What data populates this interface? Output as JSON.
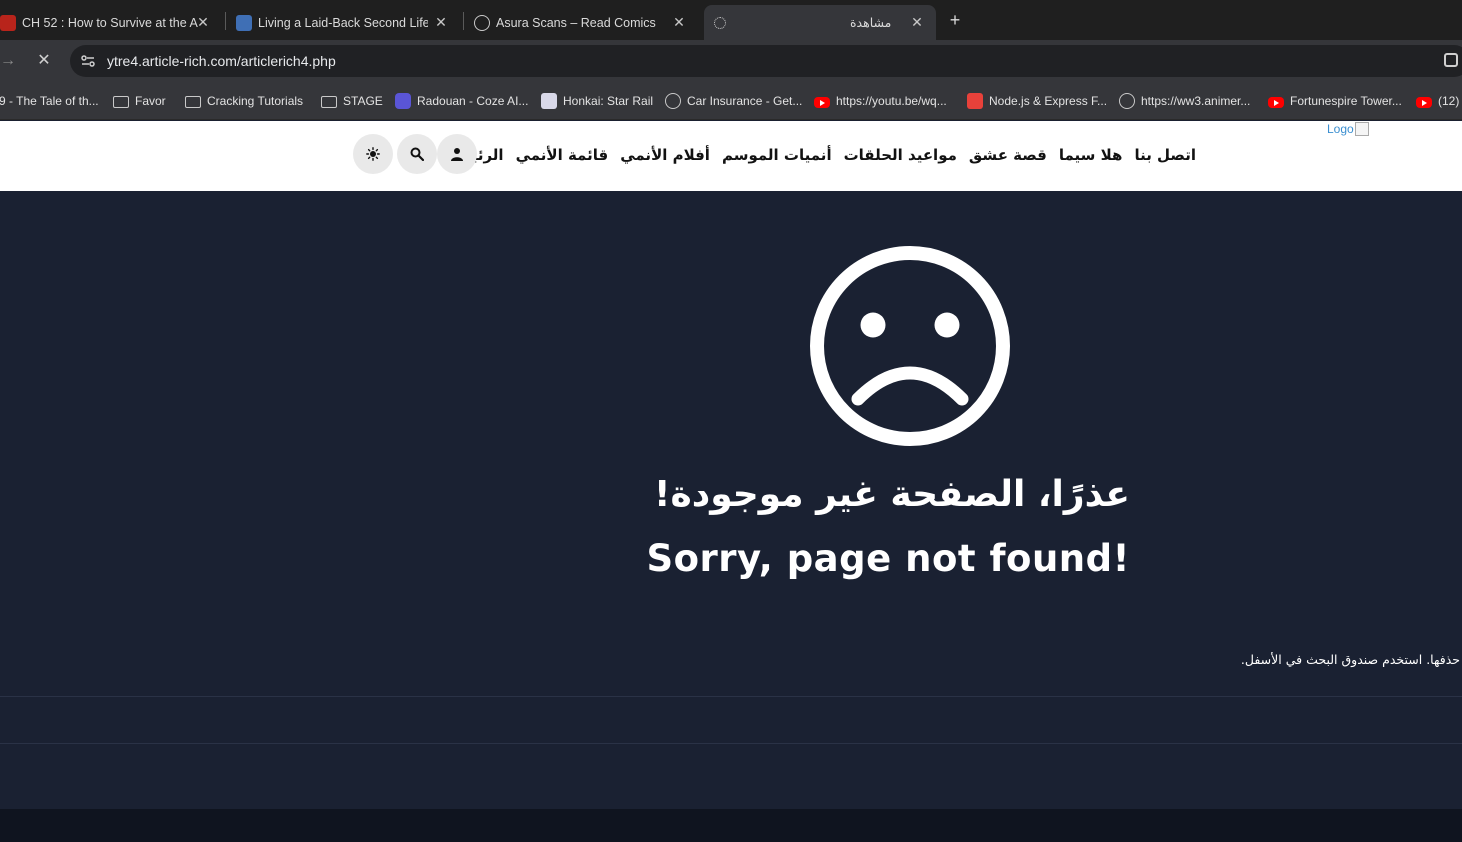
{
  "browser": {
    "tabs": [
      {
        "title": "CH 52 : How to Survive at the A",
        "favicon": "demon-icon",
        "active": false
      },
      {
        "title": "Living a Laid-Back Second Life c",
        "favicon": "manga-icon",
        "active": false
      },
      {
        "title": "Asura Scans – Read Comics",
        "favicon": "globe-icon",
        "active": false
      },
      {
        "title": "مشاهدة",
        "favicon": "loading-icon",
        "active": true
      }
    ],
    "new_tab_label": "+",
    "url": "ytre4.article-rich.com/articlerich4.php",
    "bookmarks": [
      {
        "label": "9 - The Tale of th...",
        "icon": "none"
      },
      {
        "label": "Favor",
        "icon": "folder"
      },
      {
        "label": "Cracking Tutorials",
        "icon": "folder"
      },
      {
        "label": "STAGE",
        "icon": "folder"
      },
      {
        "label": "Radouan - Coze AI...",
        "icon": "coze"
      },
      {
        "label": "Honkai: Star Rail",
        "icon": "honkai"
      },
      {
        "label": "Car Insurance - Get...",
        "icon": "globe"
      },
      {
        "label": "https://youtu.be/wq...",
        "icon": "youtube"
      },
      {
        "label": "Node.js & Express F...",
        "icon": "node"
      },
      {
        "label": "https://ww3.animer...",
        "icon": "globe"
      },
      {
        "label": "Fortunespire Tower...",
        "icon": "youtube"
      },
      {
        "label": "(12)",
        "icon": "youtube"
      }
    ]
  },
  "site": {
    "logo_alt": "Logo",
    "menu": [
      "الرئيسية",
      "قائمة الأنمي",
      "أفلام الأنمي",
      "أنميات الموسم",
      "مواعيد الحلقات",
      "قصة عشق",
      "هلا سيما",
      "اتصل بنا"
    ],
    "header_buttons": [
      "user-icon",
      "search-icon",
      "theme-icon"
    ]
  },
  "error": {
    "title_ar": "عذرًا، الصفحة غير موجودة!",
    "title_en": "Sorry, page not found!",
    "hint": "حذفها. استخدم صندوق البحث في الأسفل."
  },
  "colors": {
    "page_bg": "#1a2132",
    "footer_bg": "#0f141f",
    "header_bg": "#ffffff"
  }
}
